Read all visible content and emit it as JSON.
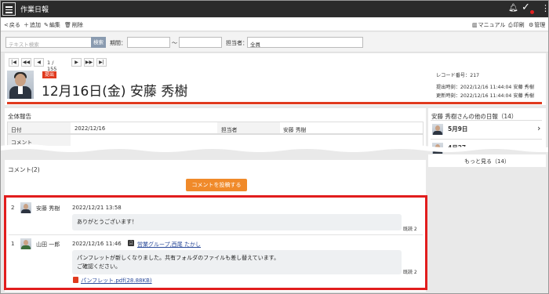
{
  "app": {
    "title": "作業日報"
  },
  "toolbar": {
    "back": "戻る",
    "add": "追加",
    "edit": "編集",
    "delete": "削除",
    "manual": "マニュアル",
    "print": "印刷",
    "admin": "管理"
  },
  "search": {
    "placeholder": "テキスト検索",
    "button": "検索",
    "period_label": "期間：",
    "tilde": "～",
    "owner_label": "担当者：",
    "owner_value": "全員"
  },
  "pager": {
    "count": "1 / 155",
    "first": "|◀",
    "prev_page": "◀◀",
    "prev": "◀",
    "next": "▶",
    "next_page": "▶▶",
    "last": "▶|"
  },
  "report": {
    "badge": "提出",
    "title": "12月16日(金) 安藤 秀樹",
    "record_no": "レコード番号：217",
    "submitted_at": "提出時刻：2022/12/16 11:44:04 安藤 秀樹",
    "updated_at": "更新時刻：2022/12/16 11:44:04 安藤 秀樹"
  },
  "overall": {
    "title": "全体報告",
    "date_label": "日付",
    "date_value": "2022/12/16",
    "owner_label": "担当者",
    "owner_value": "安藤 秀樹",
    "comment_label": "コメント"
  },
  "others": {
    "title": "安藤 秀樹さんの他の日報（14）",
    "item1": "5月9日",
    "item2": "4月27",
    "more": "もっと見る（14）"
  },
  "comments": {
    "title": "コメント(2)",
    "post_button": "コメントを投稿する",
    "items": [
      {
        "num": "2",
        "name": "安藤 秀樹",
        "date": "2022/12/21 13:58",
        "text": "ありがとうございます！",
        "read": "既読 2"
      },
      {
        "num": "1",
        "name": "山田 一郎",
        "date": "2022/12/16 11:46",
        "group": "営業グループ,西尾 たかし",
        "text1": "パンフレットが新しくなりました。共有フォルダのファイルも差し替えています。",
        "text2": "ご確認ください。",
        "read": "既読 2",
        "attachment": "パンフレット.pdf(28.88KB)"
      }
    ]
  },
  "colors": {
    "accent_red": "#e03a1e",
    "highlight_red": "#e11d1d",
    "post_orange": "#f08a2a",
    "topbar": "#2b2b2b"
  }
}
